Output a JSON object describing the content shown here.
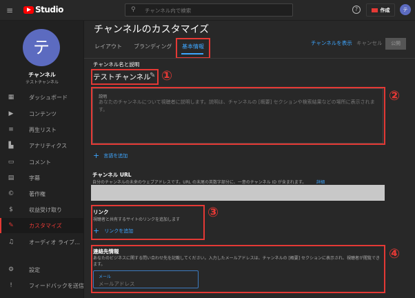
{
  "header": {
    "app_name": "Studio",
    "search_placeholder": "チャンネル内で検索",
    "create_label": "作成",
    "avatar_letter": "テ"
  },
  "sidebar": {
    "avatar_letter": "テ",
    "channel_label": "チャンネル",
    "channel_name": "テストチャンネル",
    "items": [
      {
        "label": "ダッシュボード",
        "icon": "▦"
      },
      {
        "label": "コンテンツ",
        "icon": "▶"
      },
      {
        "label": "再生リスト",
        "icon": "≡"
      },
      {
        "label": "アナリティクス",
        "icon": "▙"
      },
      {
        "label": "コメント",
        "icon": "▭"
      },
      {
        "label": "字幕",
        "icon": "▤"
      },
      {
        "label": "著作権",
        "icon": "©"
      },
      {
        "label": "収益受け取り",
        "icon": "$"
      },
      {
        "label": "カスタマイズ",
        "icon": "✎"
      },
      {
        "label": "オーディオ ライブ…",
        "icon": "♫"
      }
    ],
    "bottom": [
      {
        "label": "設定",
        "icon": "⚙"
      },
      {
        "label": "フィードバックを送信",
        "icon": "!"
      }
    ]
  },
  "main": {
    "title": "チャンネルのカスタマイズ",
    "tabs": [
      "レイアウト",
      "ブランディング",
      "基本情報"
    ],
    "view_channel": "チャンネルを表示",
    "cancel": "キャンセル",
    "publish": "公開",
    "name_section_label": "チャンネル名と説明",
    "channel_name": "テストチャンネル",
    "description_label": "説明",
    "description_placeholder": "あなたのチャンネルについて視聴者に説明します。説明は、チャンネルの [概要] セクションや検索結果などの場所に表示されます。",
    "add_language": "言語を追加",
    "url_title": "チャンネル URL",
    "url_desc": "自分のチャンネルの未来のウェブアドレスです。URL の末尾の英数字部分に、一意のチャンネル ID が含まれます。",
    "url_more": "詳細",
    "links_title": "リンク",
    "links_desc": "視聴者と共有するサイトのリンクを追加します",
    "add_link": "リンクを追加",
    "contact_title": "連絡先情報",
    "contact_desc": "あなたのビジネスに関する問い合わせ先を記載してください。入力したメールアドレスは、チャンネルの [概要] セクションに表示され、視聴者が閲覧できます。",
    "email_label": "メール",
    "email_placeholder": "メールアドレス"
  },
  "annotations": [
    "①",
    "②",
    "③",
    "④"
  ]
}
